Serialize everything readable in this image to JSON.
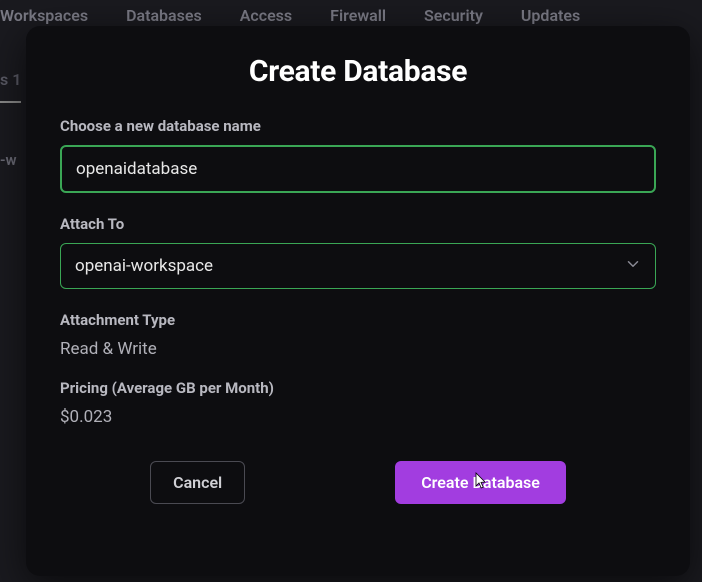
{
  "nav": {
    "items": [
      "Workspaces",
      "Databases",
      "Access",
      "Firewall",
      "Security",
      "Updates"
    ]
  },
  "bg": {
    "frag1": "s   1",
    "frag2": "-w"
  },
  "modal": {
    "title": "Create Database",
    "name_label": "Choose a new database name",
    "name_value": "openaidatabase",
    "attach_label": "Attach To",
    "attach_value": "openai-workspace",
    "attachment_type_label": "Attachment Type",
    "attachment_type_value": "Read & Write",
    "pricing_label": "Pricing (Average GB per Month)",
    "pricing_value": "$0.023",
    "cancel_label": "Cancel",
    "submit_label": "Create Database"
  }
}
